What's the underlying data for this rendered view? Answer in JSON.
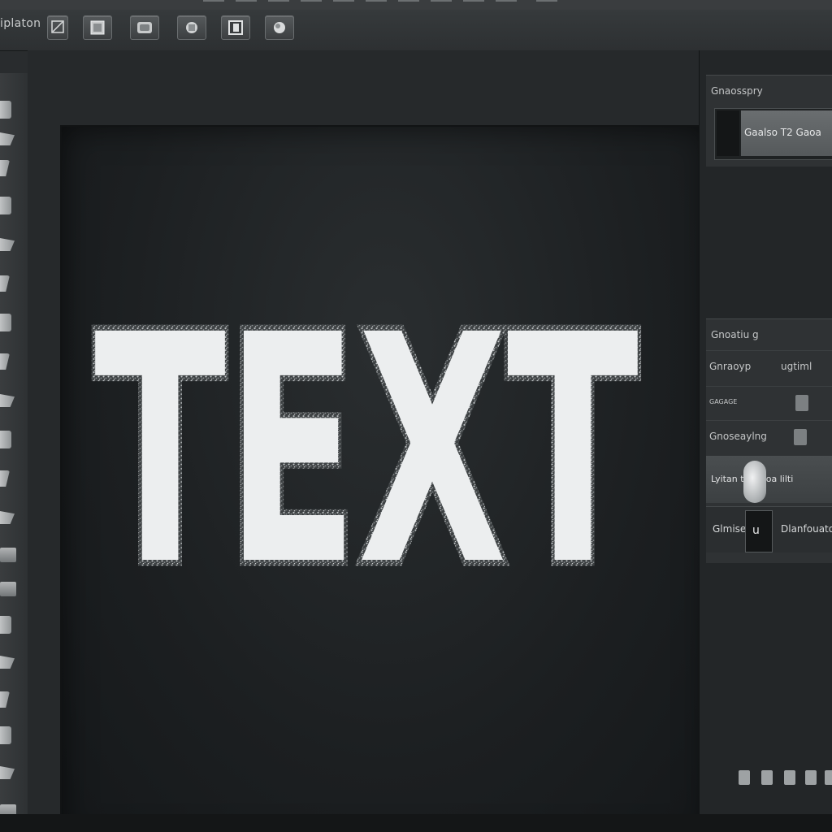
{
  "app": {
    "menu_items": [
      "",
      "",
      "",
      "",
      "",
      "",
      "",
      "",
      "",
      "",
      "",
      "",
      "",
      "",
      "",
      "",
      "",
      "",
      "",
      "",
      "",
      ""
    ]
  },
  "options_bar": {
    "tool_name": "iplaton",
    "buttons": [
      {
        "name": "layout-icon"
      },
      {
        "name": "frame-icon"
      },
      {
        "name": "image-icon"
      },
      {
        "name": "crop-icon"
      },
      {
        "name": "layers-icon"
      },
      {
        "name": "shape-icon"
      }
    ]
  },
  "toolbar": {
    "tools": [
      "move-icon",
      "marquee-icon",
      "lasso-icon",
      "wand-icon",
      "crop-icon",
      "eyedropper-icon",
      "healing-icon",
      "brush-icon",
      "stamp-icon",
      "history-brush-icon",
      "eraser-icon",
      "gradient-icon",
      "blur-icon",
      "dodge-icon",
      "pen-icon",
      "type-icon",
      "path-select-icon",
      "shape-icon",
      "hand-icon",
      "zoom-icon",
      "foreground-color-icon",
      "background-color-icon",
      "quick-mask-icon",
      "screen-mode-icon"
    ]
  },
  "canvas": {
    "text": "TEXT",
    "text_fill": "#eceeef",
    "stroke_color": "#8f9496"
  },
  "panels": {
    "properties": {
      "title": "Gnaosspry",
      "swatch_label": "Gaalso T2 Gaoa"
    },
    "character": {
      "title": "Gnoatiu g",
      "rows": [
        {
          "label": "Gnraoyp",
          "value": "ugtiml"
        },
        {
          "label": "GAGAGE",
          "value": ""
        },
        {
          "label": "Gnoseaylng",
          "value": ""
        }
      ],
      "slider_label": "Lyitan tiu anoa lilti",
      "layer_label": "Glmise",
      "layer_thumb": "u",
      "layer_name": "Dlanfouato"
    }
  },
  "colors": {
    "background": "#1b1d1e",
    "panel": "#2f3234",
    "accent_light": "#eceeef"
  }
}
